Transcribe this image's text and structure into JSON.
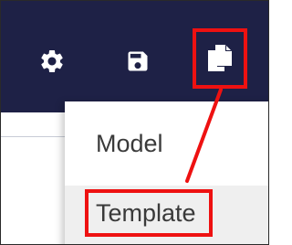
{
  "toolbar": {
    "background_color": "#1e2146",
    "icons": [
      "gear-icon",
      "floppy-disk-icon",
      "copy-documents-icon"
    ]
  },
  "menu": {
    "items": [
      {
        "label": "Model"
      },
      {
        "label": "Template"
      }
    ]
  },
  "annotation": {
    "highlight_color": "#ee1111"
  }
}
